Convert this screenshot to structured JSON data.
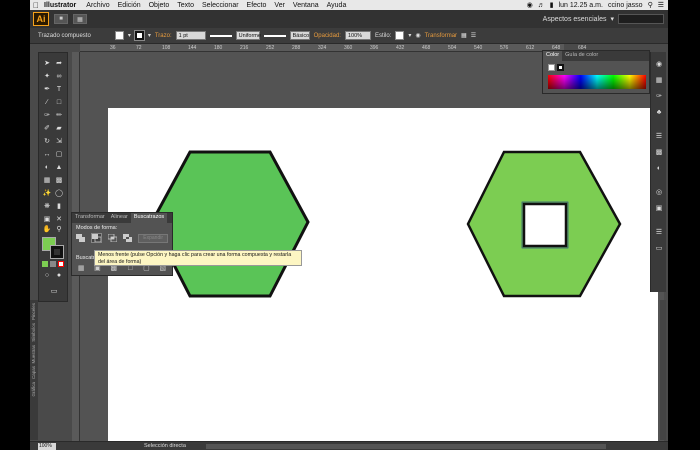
{
  "menubar": {
    "app_name": "Illustrator",
    "items": [
      "Archivo",
      "Edición",
      "Objeto",
      "Texto",
      "Seleccionar",
      "Efecto",
      "Ver",
      "Ventana",
      "Ayuda"
    ],
    "clock": "lun 12.25 a.m.",
    "user": "ccino jasso"
  },
  "appbar": {
    "logo": "Ai",
    "workspace": "Aspectos esenciales"
  },
  "control": {
    "object_type": "Trazado compuesto",
    "stroke_label": "Trazo:",
    "stroke_value": "1 pt",
    "profile": "Uniforme",
    "brush": "Básico",
    "opacity_label": "Opacidad:",
    "opacity_value": "100%",
    "style_label": "Estilo:",
    "transform_label": "Transformar"
  },
  "ruler": {
    "ticks": [
      "36",
      "72",
      "108",
      "144",
      "180",
      "216",
      "252",
      "288",
      "324",
      "360",
      "396",
      "432",
      "468",
      "504",
      "540",
      "576",
      "612",
      "648",
      "684"
    ]
  },
  "color_panel": {
    "tab_color": "Color",
    "tab_guide": "Guía de color"
  },
  "pathfinder": {
    "tabs": [
      "Transformar",
      "Alinear",
      "Buscatrazos"
    ],
    "shape_modes_label": "Modos de forma:",
    "expand_label": "Expandir",
    "pathfinders_label": "Buscatrazos:"
  },
  "tooltip": {
    "text": "Menos frente (pulse Opción y haga clic para crear una forma compuesta y restarla del área de forma)"
  },
  "statusbar": {
    "zoom": "100%",
    "tool": "Selección directa"
  },
  "vertical_tabs": [
    "Pinceles",
    "Símbolos",
    "Muestras",
    "Capas",
    "Gráfica"
  ],
  "colors": {
    "hex_fill_left": "#5ac457",
    "hex_fill_right": "#7ccd52",
    "stroke": "#111111",
    "accent_orange": "#e79b3e"
  },
  "icons": {
    "tools": [
      "selection-icon",
      "direct-selection-icon",
      "magic-wand-icon",
      "lasso-icon",
      "pen-icon",
      "type-icon",
      "line-icon",
      "rectangle-icon",
      "paintbrush-icon",
      "pencil-icon",
      "blob-brush-icon",
      "eraser-icon",
      "rotate-icon",
      "scale-icon",
      "width-icon",
      "free-transform-icon",
      "shape-builder-icon",
      "perspective-icon",
      "mesh-icon",
      "gradient-icon",
      "eyedropper-icon",
      "blend-icon",
      "symbol-sprayer-icon",
      "graph-icon",
      "artboard-icon",
      "slice-icon",
      "hand-icon",
      "zoom-icon"
    ],
    "dock": [
      "color-panel-icon",
      "swatches-icon",
      "brushes-icon",
      "symbols-icon",
      "stroke-icon",
      "gradient-panel-icon",
      "transparency-icon",
      "appearance-icon",
      "graphic-styles-icon",
      "layers-icon",
      "artboards-icon"
    ]
  }
}
